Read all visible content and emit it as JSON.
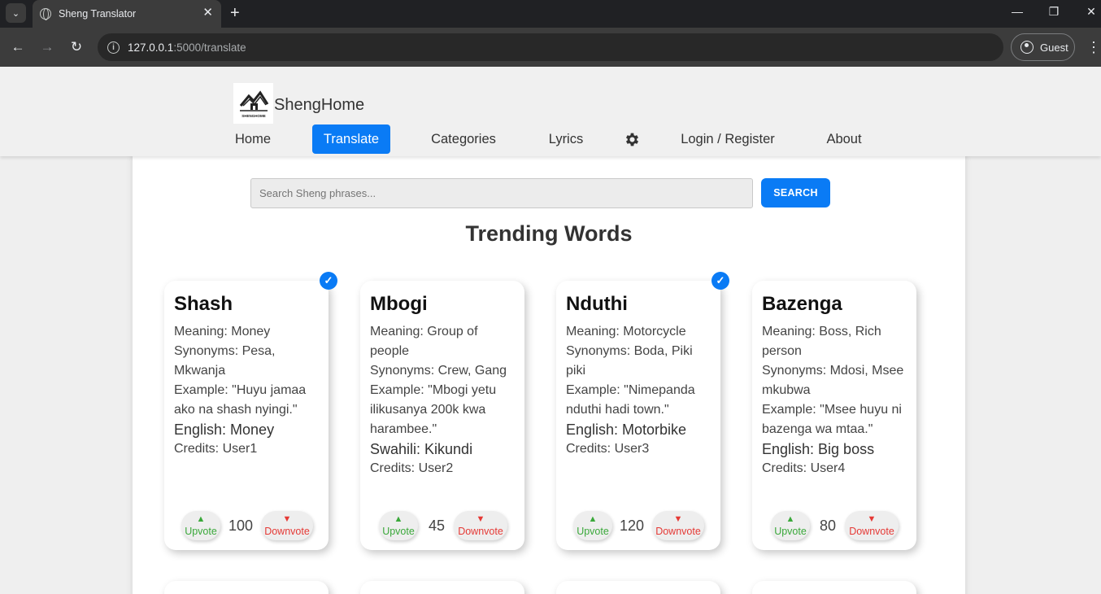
{
  "browser": {
    "tab_title": "Sheng Translator",
    "url_host": "127.0.0.1",
    "url_path": ":5000/translate",
    "profile_label": "Guest"
  },
  "header": {
    "brand": "ShengHome",
    "logo_text": "SHENGHOME",
    "menu": [
      {
        "label": "Home",
        "active": false
      },
      {
        "label": "Translate",
        "active": true
      },
      {
        "label": "Categories",
        "active": false
      },
      {
        "label": "Lyrics",
        "active": false
      },
      {
        "label": "Login / Register",
        "active": false
      },
      {
        "label": "About",
        "active": false
      }
    ],
    "settings_icon": "gear-icon"
  },
  "search": {
    "placeholder": "Search Sheng phrases...",
    "button_label": "SEARCH"
  },
  "section_title": "Trending Words",
  "cards": [
    {
      "word": "Shash",
      "verified": true,
      "meaning": "Meaning: Money",
      "synonyms": "Synonyms: Pesa, Mkwanja",
      "example": "Example: \"Huyu jamaa ako na shash nyingi.\"",
      "translation": "English: Money",
      "credits": "Credits: User1",
      "votes": "100"
    },
    {
      "word": "Mbogi",
      "verified": false,
      "meaning": "Meaning: Group of people",
      "synonyms": "Synonyms: Crew, Gang",
      "example": "Example: \"Mbogi yetu ilikusanya 200k kwa harambee.\"",
      "translation": "Swahili: Kikundi",
      "credits": "Credits: User2",
      "votes": "45"
    },
    {
      "word": "Nduthi",
      "verified": true,
      "meaning": "Meaning: Motorcycle",
      "synonyms": "Synonyms: Boda, Piki piki",
      "example": "Example: \"Nimepanda nduthi hadi town.\"",
      "translation": "English: Motorbike",
      "credits": "Credits: User3",
      "votes": "120"
    },
    {
      "word": "Bazenga",
      "verified": false,
      "meaning": "Meaning: Boss, Rich person",
      "synonyms": "Synonyms: Mdosi, Msee mkubwa",
      "example": "Example: \"Msee huyu ni bazenga wa mtaa.\"",
      "translation": "English: Big boss",
      "credits": "Credits: User4",
      "votes": "80"
    }
  ],
  "vote_labels": {
    "up": "Upvote",
    "down": "Downvote",
    "up_arrow": "▲",
    "down_arrow": "▼"
  },
  "colors": {
    "accent": "#0a7bf5",
    "upvote": "#3aa83a",
    "downvote": "#e53935"
  }
}
